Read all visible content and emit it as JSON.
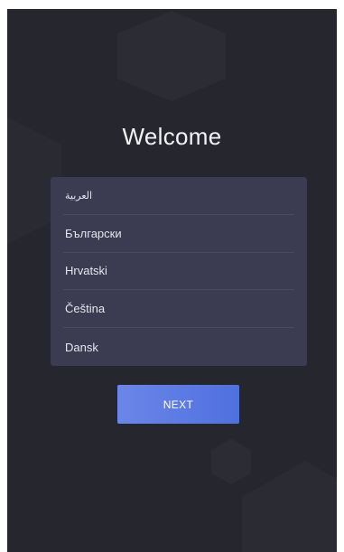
{
  "welcome": {
    "title": "Welcome"
  },
  "languages": {
    "items": [
      {
        "label": "العربية"
      },
      {
        "label": "Български"
      },
      {
        "label": "Hrvatski"
      },
      {
        "label": "Čeština"
      },
      {
        "label": "Dansk"
      }
    ]
  },
  "actions": {
    "next_label": "NEXT"
  },
  "colors": {
    "background": "#26262e",
    "list_background": "#3b3b52",
    "accent_start": "#6c86e8",
    "accent_end": "#4f70df"
  }
}
